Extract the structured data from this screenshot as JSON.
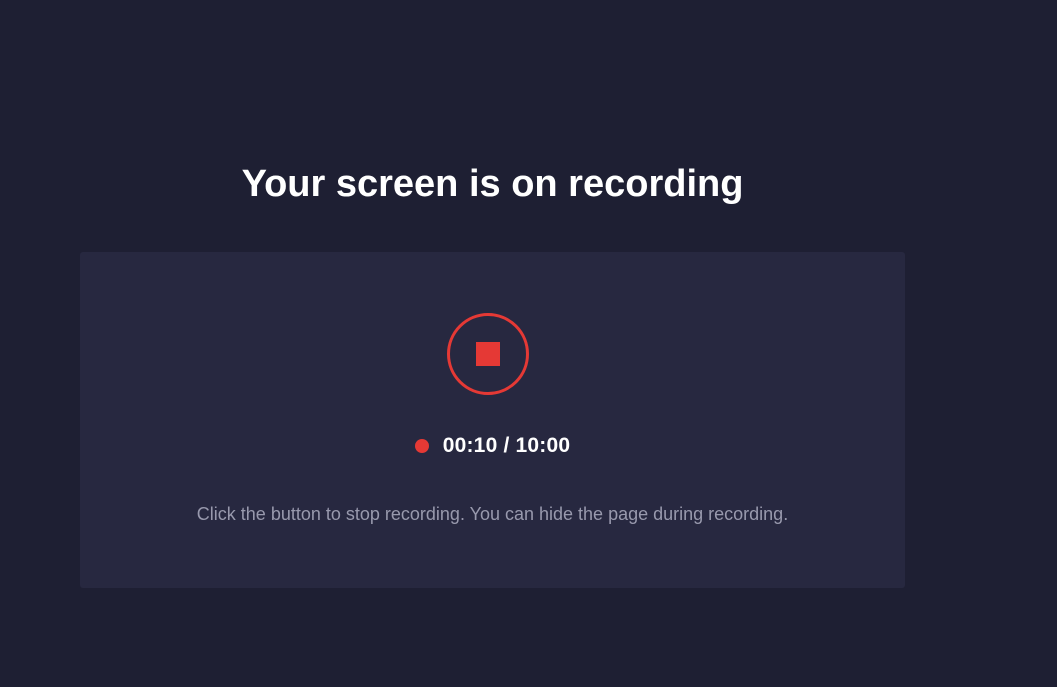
{
  "page": {
    "title": "Your screen is on recording"
  },
  "recorder": {
    "stop_button_icon": "stop-icon",
    "recording_indicator_icon": "recording-dot-icon",
    "elapsed": "00:10",
    "limit": "10:00",
    "timer_text": "00:10 / 10:00",
    "hint": "Click the button to stop recording. You can hide the page during recording."
  },
  "colors": {
    "background": "#1e1f33",
    "panel": "#272840",
    "accent_red": "#e53935",
    "title_text": "#ffffff",
    "hint_text": "#9899ad"
  }
}
